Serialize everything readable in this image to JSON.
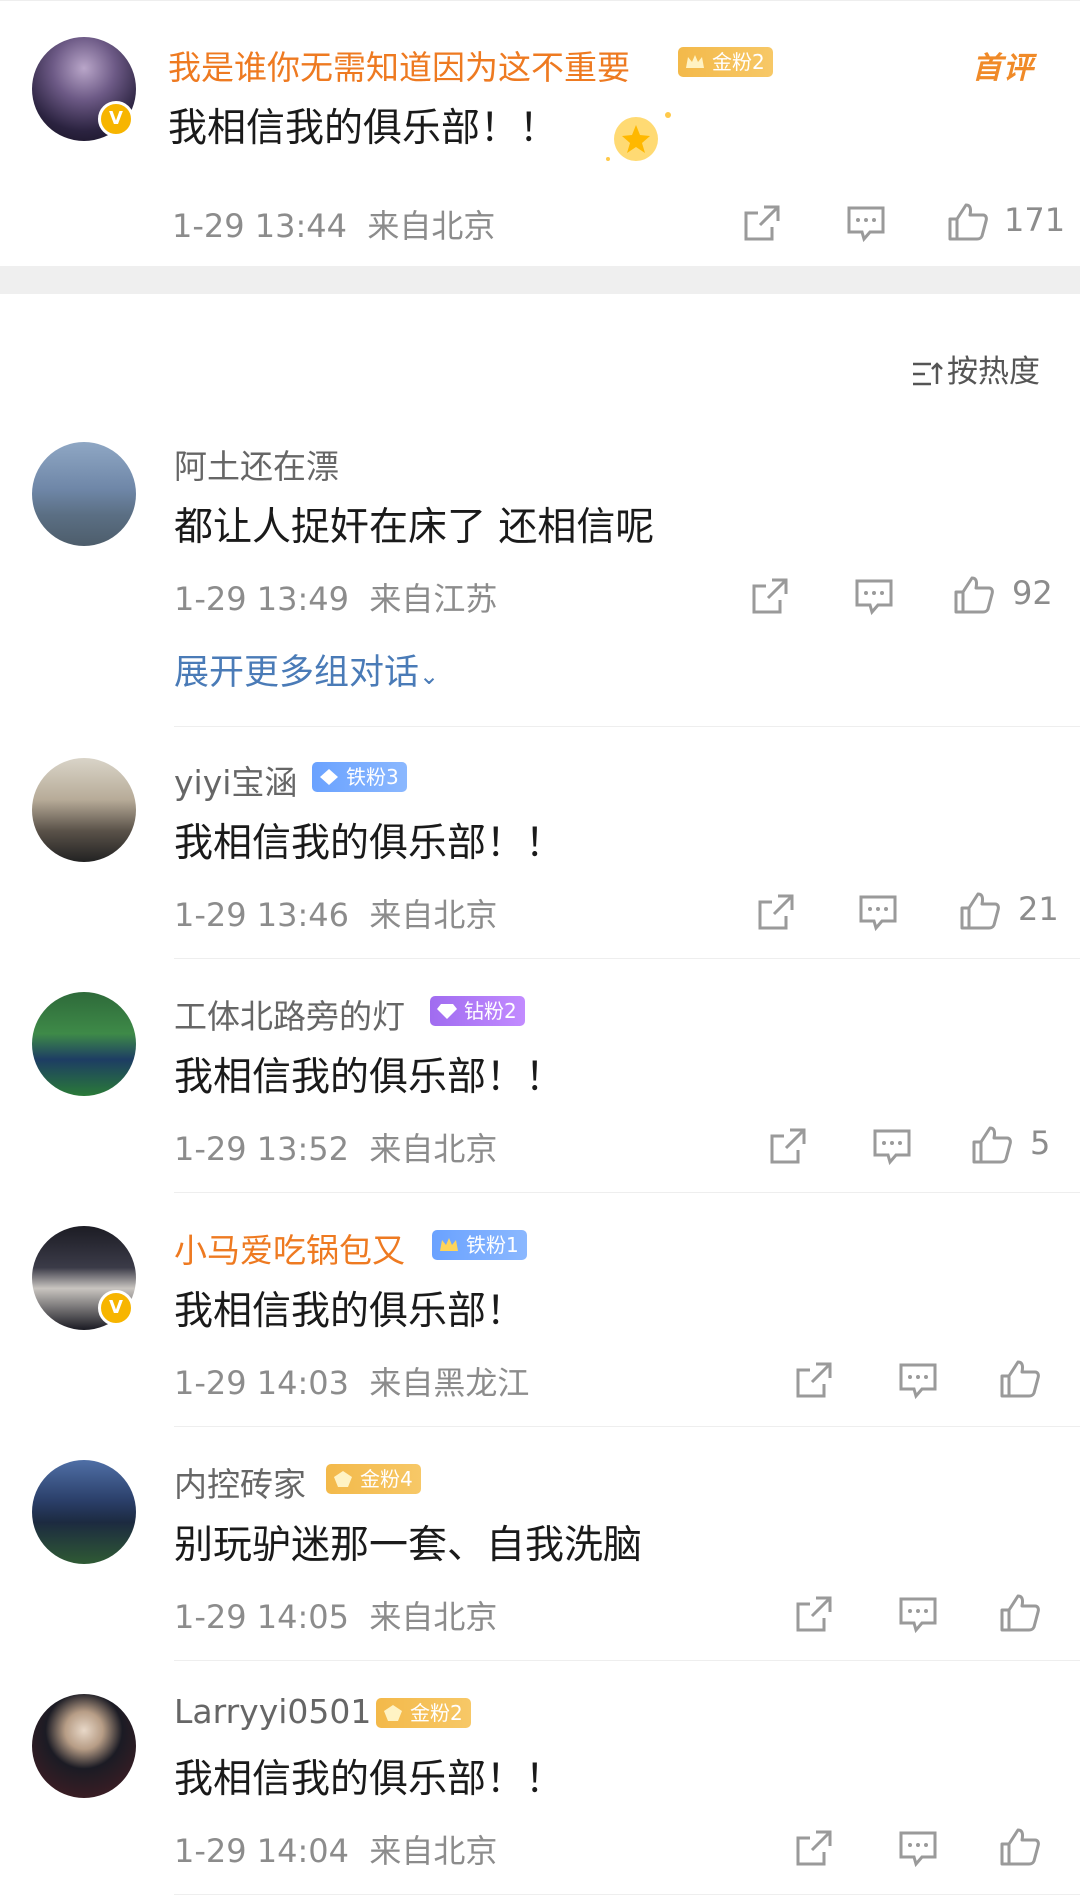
{
  "top_comment": {
    "username": "我是谁你无需知道因为这不重要",
    "fan_badge": "金粉2",
    "tag": "首评",
    "text": "我相信我的俱乐部！！",
    "time": "1-29 13:44",
    "location": "来自北京",
    "likes": "171"
  },
  "sort": {
    "label": "按热度"
  },
  "comments": [
    {
      "username": "阿土还在漂",
      "badge": "",
      "text": "都让人捉奸在床了 还相信呢",
      "time": "1-29 13:49",
      "location": "来自江苏",
      "likes": "92"
    },
    {
      "username": "yiyi宝涵",
      "badge": "铁粉3",
      "text": "我相信我的俱乐部！！",
      "time": "1-29 13:46",
      "location": "来自北京",
      "likes": "21"
    },
    {
      "username": "工体北路旁的灯",
      "badge": "钻粉2",
      "text": "我相信我的俱乐部！！",
      "time": "1-29 13:52",
      "location": "来自北京",
      "likes": "5"
    },
    {
      "username": "小马爱吃锅包又",
      "badge": "铁粉1",
      "text": "我相信我的俱乐部！",
      "time": "1-29 14:03",
      "location": "来自黑龙江",
      "likes": ""
    },
    {
      "username": "内控砖家",
      "badge": "金粉4",
      "text": "别玩驴迷那一套、自我洗脑",
      "time": "1-29 14:05",
      "location": "来自北京",
      "likes": ""
    },
    {
      "username": "Larryyi0501",
      "badge": "金粉2",
      "text": "我相信我的俱乐部！！",
      "time": "1-29 14:04",
      "location": "来自北京",
      "likes": ""
    }
  ],
  "expand_replies": "展开更多组对话",
  "icons": [
    "share-icon",
    "comment-icon",
    "like-icon",
    "verified-icon",
    "chevron-down-icon",
    "sort-icon"
  ],
  "colors": {
    "gold_name": "#ee7a21",
    "link_blue": "#4a7bb7",
    "meta_gray": "#8c8c8c"
  }
}
